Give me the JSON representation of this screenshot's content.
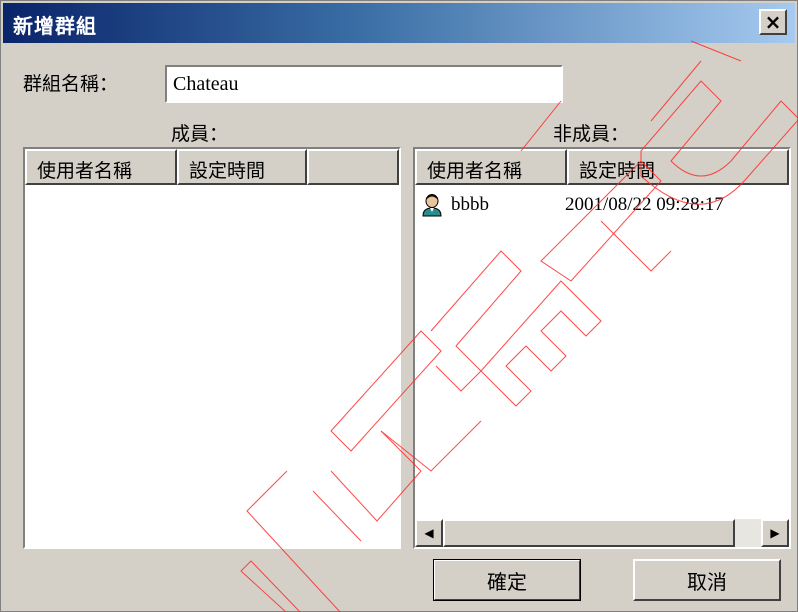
{
  "window": {
    "title": "新增群組",
    "close_glyph": "×"
  },
  "group_name": {
    "label": "群組名稱：",
    "value": "Chateau"
  },
  "members": {
    "label": "成員：",
    "columns": [
      "使用者名稱",
      "設定時間"
    ],
    "rows": []
  },
  "non_members": {
    "label": "非成員：",
    "columns": [
      "使用者名稱",
      "設定時間"
    ],
    "rows": [
      {
        "icon": "user-icon",
        "name": "bbbb",
        "time": "2001/08/22 09:28:17"
      }
    ]
  },
  "scrollbar": {
    "left_glyph": "◀",
    "right_glyph": "▶"
  },
  "buttons": {
    "ok": "確定",
    "cancel": "取消"
  },
  "watermark": {
    "text": "CHATEAU",
    "color": "#ff0000"
  }
}
